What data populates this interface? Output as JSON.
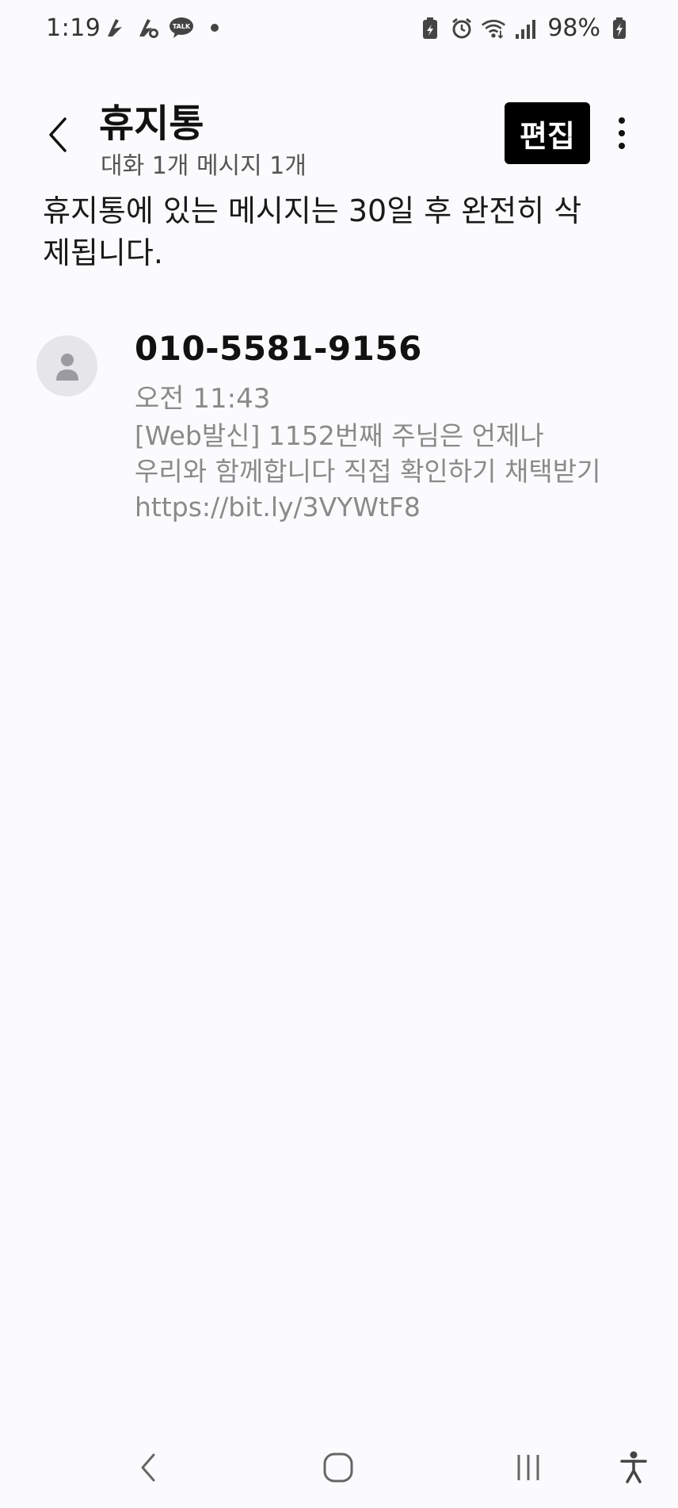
{
  "status_bar": {
    "time": "1:19",
    "notification_icons": [
      "app-notification-icon",
      "app-notification-icon",
      "kakaotalk-icon",
      "dot-icon"
    ],
    "kakaotalk_label": "TALK",
    "battery_percent": "98%"
  },
  "header": {
    "title": "휴지통",
    "subtitle": "대화 1개 메시지 1개",
    "edit_label": "편집"
  },
  "notice": {
    "text": "휴지통에 있는 메시지는 30일 후 완전히 삭제됩니다."
  },
  "messages": [
    {
      "sender": "010-5581-9156",
      "time": "오전 11:43",
      "preview": "[Web발신] 1152번째 주님은 언제나\n우리와 함께합니다 직접 확인하기 채택받기\nhttps://bit.ly/3VYWtF8"
    }
  ],
  "colors": {
    "background": "#fbfbfd",
    "edit_button_bg": "#000000",
    "secondary_text": "#8a8a8a"
  }
}
